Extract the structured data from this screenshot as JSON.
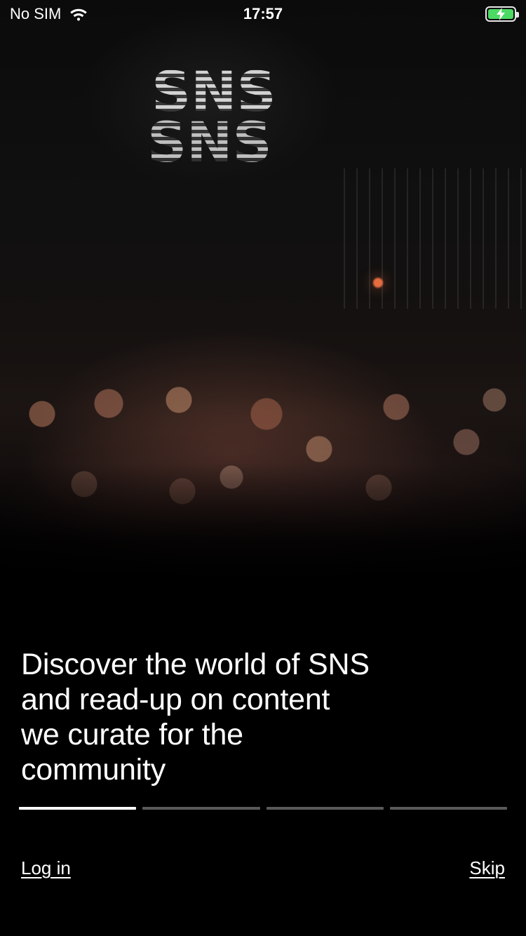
{
  "status_bar": {
    "carrier": "No SIM",
    "time": "17:57",
    "battery": {
      "charging": true,
      "level": 1.0,
      "fill_color": "#4cd964"
    },
    "icons": {
      "wifi": "wifi-icon",
      "battery": "battery-icon",
      "charging": "lightning-icon"
    }
  },
  "hero": {
    "logo_text": "SNS"
  },
  "onboarding": {
    "headline": "Discover the world of SNS\nand read-up on content\nwe curate for the\ncommunity",
    "pager": {
      "total": 4,
      "active_index": 0
    },
    "actions": {
      "login_label": "Log in",
      "skip_label": "Skip"
    }
  }
}
